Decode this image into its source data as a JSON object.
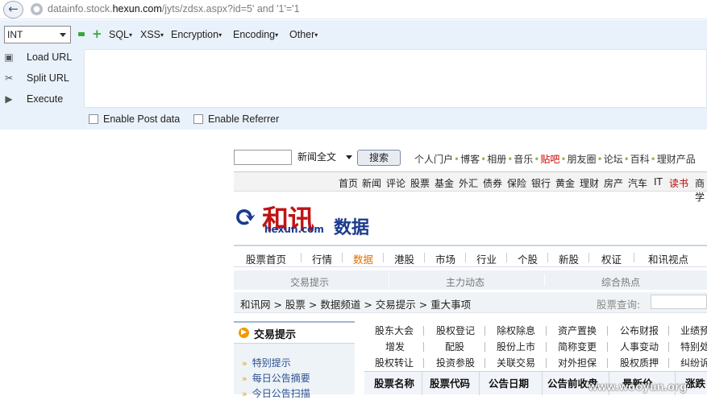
{
  "browser": {
    "url_prefix": "datainfo.stock.",
    "url_host": "hexun.com",
    "url_path": "/jyts/zdsx.aspx?id=5' and '1'='1"
  },
  "hackbar": {
    "select_value": "INT",
    "menus": [
      "SQL",
      "XSS",
      "Encryption",
      "Encoding",
      "Other"
    ],
    "load_url": "Load URL",
    "split_url": "Split URL",
    "execute": "Execute",
    "enable_post": "Enable Post data",
    "enable_referrer": "Enable Referrer"
  },
  "page": {
    "search_select": "新闻全文",
    "search_button": "搜索",
    "portal_links": [
      "个人门户",
      "博客",
      "相册",
      "音乐",
      "贴吧",
      "朋友圈",
      "论坛",
      "百科",
      "理财产品"
    ],
    "channels": [
      "首页",
      "新闻",
      "评论",
      "股票",
      "基金",
      "外汇",
      "债券",
      "保险",
      "银行",
      "黄金",
      "理财",
      "房产",
      "汽车",
      "IT",
      "读书",
      "商学"
    ],
    "logo_text": "和讯",
    "logo_url": "hexun.com",
    "logo_sub": "数据",
    "nav": [
      "股票首页",
      "行情",
      "数据",
      "港股",
      "市场",
      "行业",
      "个股",
      "新股",
      "权证",
      "和讯视点"
    ],
    "subnav": [
      "交易提示",
      "主力动态",
      "综合热点"
    ],
    "breadcrumb": "和讯网 > 股票 > 数据频道 > 交易提示 > 重大事项",
    "stock_query": "股票查询:",
    "left_title": "交易提示",
    "left_items": [
      "特别提示",
      "每日公告摘要",
      "今日公告扫描"
    ],
    "links_row1": [
      "股东大会",
      "股权登记",
      "除权除息",
      "资产置换",
      "公布财报",
      "业绩预告"
    ],
    "links_row2": [
      "增发",
      "配股",
      "股份上市",
      "简称变更",
      "人事变动",
      "特别处理"
    ],
    "links_row3": [
      "股权转让",
      "投资参股",
      "关联交易",
      "对外担保",
      "股权质押",
      "纠纷诉讼"
    ],
    "table_headers": [
      "股票名称",
      "股票代码",
      "公告日期",
      "公告前收盘",
      "最新价",
      "涨跌"
    ],
    "watermark": "www.wooyun.org"
  }
}
